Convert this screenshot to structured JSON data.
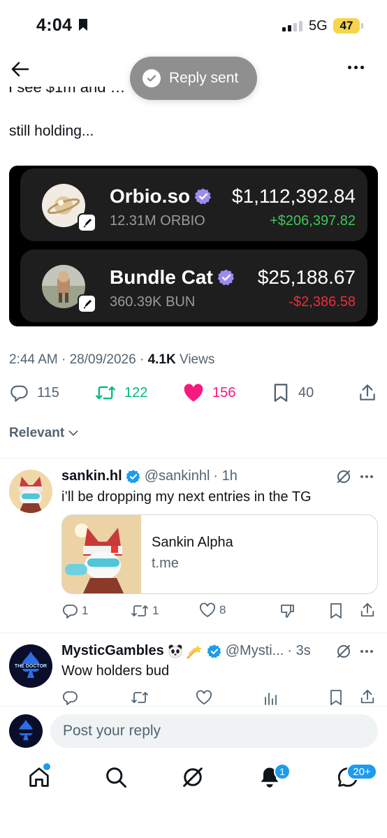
{
  "status_bar": {
    "time": "4:04",
    "network": "5G",
    "battery": "47"
  },
  "toast": {
    "text": "Reply sent"
  },
  "post": {
    "text": "still holding...",
    "card": {
      "rows": [
        {
          "name": "Orbio.so",
          "amount": "12.31M ORBIO",
          "value": "$1,112,392.84",
          "change": "+$206,397.82",
          "change_dir": "up"
        },
        {
          "name": "Bundle Cat",
          "amount": "360.39K BUN",
          "value": "$25,188.67",
          "change": "-$2,386.58",
          "change_dir": "down"
        }
      ]
    },
    "meta": {
      "time_date": "2:44 AM · 28/09/2026 · ",
      "views_count": "4.1K",
      "views_label": " Views"
    },
    "actions": {
      "replies": "115",
      "reposts": "122",
      "likes": "156",
      "bookmarks": "40"
    }
  },
  "sort": {
    "label": "Relevant"
  },
  "replies": [
    {
      "name": "sankin.hl",
      "handle": "@sankinhl",
      "time": "· 1h",
      "text": "i’ll be dropping my next entries in the TG",
      "link_card": {
        "title": "Sankin Alpha",
        "domain": "t.me"
      },
      "actions": {
        "replies": "1",
        "reposts": "1",
        "likes": "8"
      }
    },
    {
      "name": "MysticGambles",
      "handle": "@Mysti...",
      "time": "· 3s",
      "text": "Wow holders bud",
      "avatar_text": "THE DOCTOR"
    }
  ],
  "reply_input": {
    "placeholder": "Post your reply"
  },
  "tab_bar": {
    "notifications_badge": "1",
    "messages_badge": "20+"
  },
  "colors": {
    "verified": "#1d9bf0",
    "card_verified": "#9b8cf0",
    "repost": "#00ba7c",
    "like": "#f91880",
    "positive": "#3ec85a",
    "negative": "#ee2d3b"
  }
}
